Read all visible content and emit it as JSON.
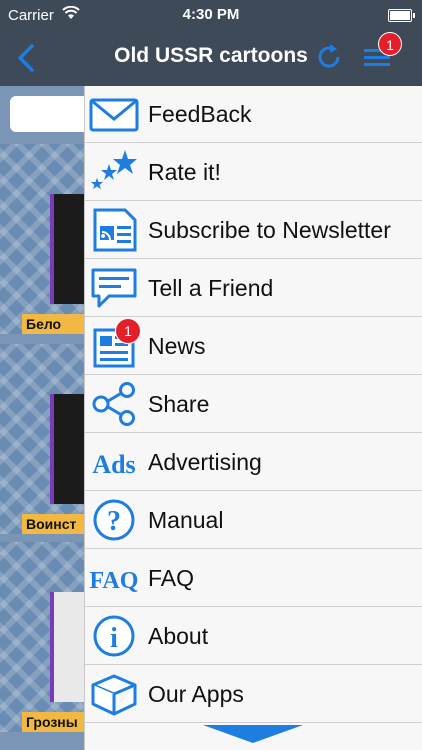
{
  "status_bar": {
    "carrier": "Carrier",
    "time": "4:30 PM"
  },
  "nav": {
    "title": "Old USSR cartoons",
    "menu_badge": "1"
  },
  "background_cells": [
    {
      "caption": "Бело"
    },
    {
      "caption": "Воинст"
    },
    {
      "caption": "Грозны"
    }
  ],
  "menu": {
    "news_badge": "1",
    "items": [
      {
        "label": "FeedBack",
        "icon": "mail-icon"
      },
      {
        "label": "Rate it!",
        "icon": "stars-icon"
      },
      {
        "label": "Subscribe to Newsletter",
        "icon": "newsletter-icon"
      },
      {
        "label": "Tell a Friend",
        "icon": "chat-icon"
      },
      {
        "label": "News",
        "icon": "news-icon"
      },
      {
        "label": "Share",
        "icon": "share-icon"
      },
      {
        "label": "Advertising",
        "icon": "ads-icon"
      },
      {
        "label": "Manual",
        "icon": "question-icon"
      },
      {
        "label": "FAQ",
        "icon": "faq-icon"
      },
      {
        "label": "About",
        "icon": "info-icon"
      },
      {
        "label": "Our Apps",
        "icon": "box-icon"
      }
    ]
  },
  "colors": {
    "accent": "#1e7de0",
    "nav_bg": "#3e4a58",
    "badge": "#e3202a"
  }
}
